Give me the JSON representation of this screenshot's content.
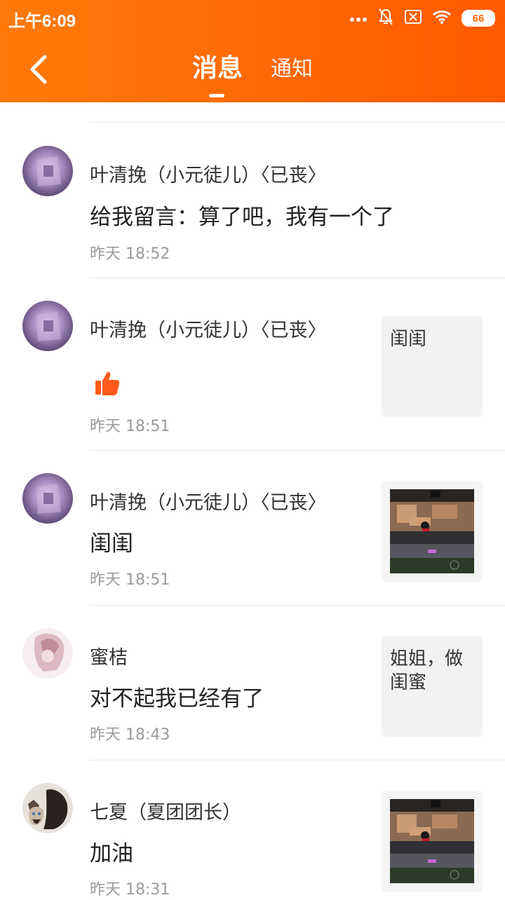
{
  "status_bar": {
    "time": "上午6:09",
    "battery": "66"
  },
  "header": {
    "tabs": [
      {
        "label": "消息",
        "active": true
      },
      {
        "label": "通知",
        "active": false
      }
    ]
  },
  "messages": [
    {
      "name": "叶清挽（小元徒儿）〈已丧〉",
      "text": "给我留言：算了吧，我有一个了",
      "time": "昨天 18:52",
      "thumb_type": "none"
    },
    {
      "name": "叶清挽（小元徒儿）〈已丧〉",
      "text": "",
      "icon": "thumbs-up-icon",
      "time": "昨天 18:51",
      "thumb_type": "text",
      "thumb_text": "闺闺"
    },
    {
      "name": "叶清挽（小元徒儿）〈已丧〉",
      "text": "闺闺",
      "time": "昨天 18:51",
      "thumb_type": "image"
    },
    {
      "name": "蜜桔",
      "text": "对不起我已经有了",
      "time": "昨天 18:43",
      "thumb_type": "text",
      "thumb_text": "姐姐，做闺蜜"
    },
    {
      "name": "七夏（夏团团长）",
      "text": "加油",
      "time": "昨天 18:31",
      "thumb_type": "image"
    }
  ],
  "colors": {
    "header_start": "#ff7a0a",
    "header_end": "#ff5a00",
    "like_icon": "#ff5a1a"
  }
}
